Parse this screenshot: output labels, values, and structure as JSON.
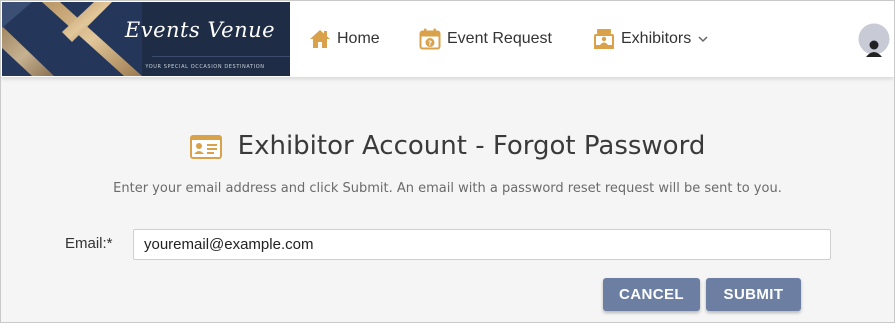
{
  "logo": {
    "script_text": "Events Venue",
    "tagline": "YOUR SPECIAL OCCASION DESTINATION"
  },
  "nav": {
    "home": {
      "label": "Home",
      "icon": "home-icon"
    },
    "event_request": {
      "label": "Event Request",
      "icon": "calendar-question-icon"
    },
    "exhibitors": {
      "label": "Exhibitors",
      "icon": "exhibitor-booth-icon",
      "has_dropdown": true
    }
  },
  "user": {
    "icon": "user-avatar-icon"
  },
  "main": {
    "title": "Exhibitor Account - Forgot Password",
    "title_icon": "id-card-icon",
    "instructions": "Enter your email address and click Submit. An email with a password reset request will be sent to you.",
    "email": {
      "label": "Email:*",
      "value": "youremail@example.com"
    },
    "buttons": {
      "cancel": "CANCEL",
      "submit": "SUBMIT"
    }
  },
  "colors": {
    "accent_gold": "#d9a24a",
    "button_bg": "#6c7fa3",
    "logo_bg": "#1e2d45"
  }
}
